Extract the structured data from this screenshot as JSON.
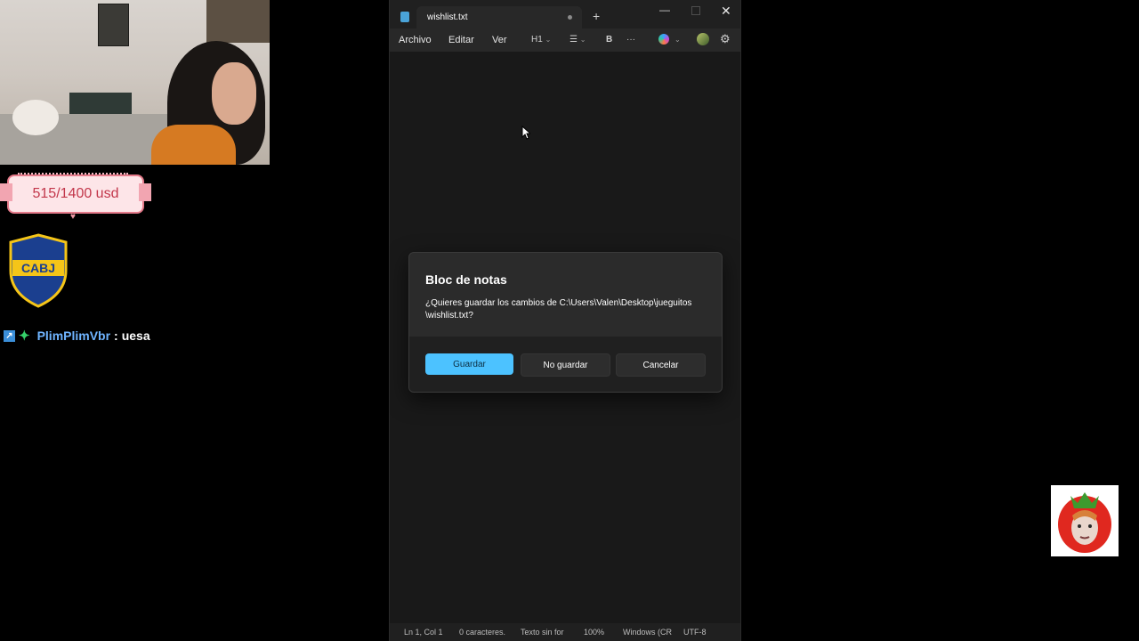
{
  "overlay": {
    "goal_text": "515/1400 usd",
    "crest_text": "CABJ",
    "chat": {
      "username": "PlimPlimVbr",
      "separator": ":",
      "message": "uesa"
    }
  },
  "notepad": {
    "tab_title": "wishlist.txt",
    "new_tab": "+",
    "window_controls": {
      "minimize": "—",
      "close": "✕"
    },
    "menu": [
      "Archivo",
      "Editar",
      "Ver"
    ],
    "toolbar": {
      "heading": "H1",
      "list_icon": "list-icon",
      "bold": "B",
      "more": "···",
      "copilot_icon": "copilot-icon",
      "settings": "⚙"
    },
    "status": {
      "position": "Ln 1, Col 1",
      "chars": "0 caracteres.",
      "format": "Texto sin for",
      "zoom": "100%",
      "line_ending": "Windows (CR",
      "encoding": "UTF-8"
    }
  },
  "dialog": {
    "title": "Bloc de notas",
    "message": "¿Quieres guardar los cambios de C:\\Users\\Valen\\Desktop\\jueguitos \\wishlist.txt?",
    "buttons": {
      "save": "Guardar",
      "dont_save": "No guardar",
      "cancel": "Cancelar"
    }
  },
  "colors": {
    "accent": "#4cc2ff",
    "editor_bg": "#191919",
    "chat_username": "#6fb4ff"
  }
}
